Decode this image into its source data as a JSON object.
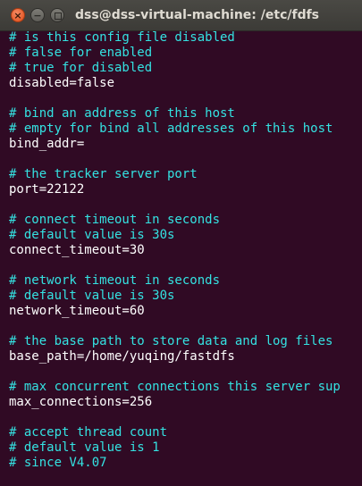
{
  "window": {
    "title": "dss@dss-virtual-machine: /etc/fdfs",
    "buttons": {
      "close": "×",
      "minimize": "−"
    }
  },
  "colors": {
    "background": "#300a24",
    "comment": "#34e2e2",
    "text": "#ffffff"
  },
  "terminal": {
    "lines": [
      {
        "kind": "comment",
        "text": "# is this config file disabled"
      },
      {
        "kind": "comment",
        "text": "# false for enabled"
      },
      {
        "kind": "comment",
        "text": "# true for disabled"
      },
      {
        "kind": "text",
        "text": "disabled=false"
      },
      {
        "kind": "blank",
        "text": ""
      },
      {
        "kind": "comment",
        "text": "# bind an address of this host"
      },
      {
        "kind": "comment",
        "text": "# empty for bind all addresses of this host"
      },
      {
        "kind": "text",
        "text": "bind_addr="
      },
      {
        "kind": "blank",
        "text": ""
      },
      {
        "kind": "comment",
        "text": "# the tracker server port"
      },
      {
        "kind": "text",
        "text": "port=22122"
      },
      {
        "kind": "blank",
        "text": ""
      },
      {
        "kind": "comment",
        "text": "# connect timeout in seconds"
      },
      {
        "kind": "comment",
        "text": "# default value is 30s"
      },
      {
        "kind": "text",
        "text": "connect_timeout=30"
      },
      {
        "kind": "blank",
        "text": ""
      },
      {
        "kind": "comment",
        "text": "# network timeout in seconds"
      },
      {
        "kind": "comment",
        "text": "# default value is 30s"
      },
      {
        "kind": "text",
        "text": "network_timeout=60"
      },
      {
        "kind": "blank",
        "text": ""
      },
      {
        "kind": "comment",
        "text": "# the base path to store data and log files"
      },
      {
        "kind": "text",
        "text": "base_path=/home/yuqing/fastdfs"
      },
      {
        "kind": "blank",
        "text": ""
      },
      {
        "kind": "comment",
        "text": "# max concurrent connections this server sup"
      },
      {
        "kind": "text",
        "text": "max_connections=256"
      },
      {
        "kind": "blank",
        "text": ""
      },
      {
        "kind": "comment",
        "text": "# accept thread count"
      },
      {
        "kind": "comment",
        "text": "# default value is 1"
      },
      {
        "kind": "comment",
        "text": "# since V4.07"
      }
    ]
  }
}
